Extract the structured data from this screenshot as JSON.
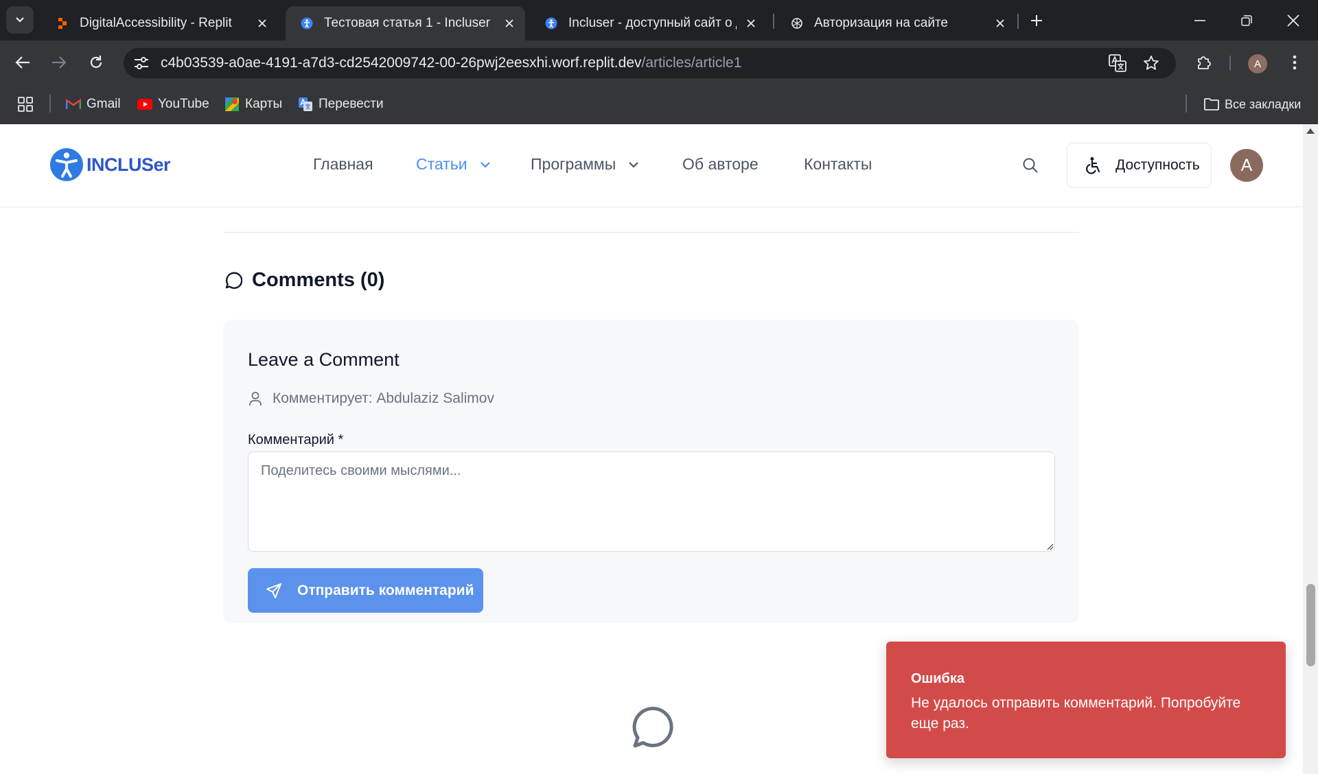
{
  "browser": {
    "tabs": [
      {
        "title": "DigitalAccessibility - Replit",
        "active": false
      },
      {
        "title": "Тестовая статья 1 - Incluser",
        "active": true
      },
      {
        "title": "Incluser - доступный сайт о до",
        "active": false
      },
      {
        "title": "Авторизация на сайте",
        "active": false
      }
    ],
    "url_host": "c4b03539-a0ae-4191-a7d3-cd2542009742-00-26pwj2eesxhi.worf.replit.dev",
    "url_path": "/articles/article1",
    "profile_initial": "A",
    "bookmarks": [
      {
        "label": "Gmail",
        "icon": "gmail-icon"
      },
      {
        "label": "YouTube",
        "icon": "youtube-icon"
      },
      {
        "label": "Карты",
        "icon": "maps-icon"
      },
      {
        "label": "Перевести",
        "icon": "translate-icon"
      }
    ],
    "all_bookmarks": "Все закладки"
  },
  "site": {
    "logo_text": "INCLUSer",
    "nav": [
      {
        "label": "Главная",
        "has_dropdown": false,
        "active": false
      },
      {
        "label": "Статьи",
        "has_dropdown": true,
        "active": true
      },
      {
        "label": "Программы",
        "has_dropdown": true,
        "active": false
      },
      {
        "label": "Об авторе",
        "has_dropdown": false,
        "active": false
      },
      {
        "label": "Контакты",
        "has_dropdown": false,
        "active": false
      }
    ],
    "accessibility_label": "Доступность",
    "avatar_initial": "A"
  },
  "comments": {
    "heading": "Comments (0)",
    "form_title": "Leave a Comment",
    "commenter": "Комментирует: Abdulaziz Salimov",
    "field_label": "Комментарий *",
    "placeholder": "Поделитесь своими мыслями...",
    "value": "",
    "submit_label": "Отправить комментарий"
  },
  "toast": {
    "title": "Ошибка",
    "message": "Не удалось отправить комментарий. Попробуйте еще раз."
  },
  "colors": {
    "accent": "#4a8ef0",
    "button": "#5b92ec",
    "error": "#d34b49",
    "logo": "#2b58c9"
  }
}
